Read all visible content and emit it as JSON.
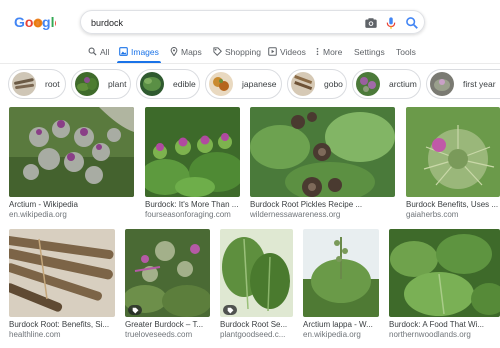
{
  "logo": {
    "text": "Google"
  },
  "search": {
    "query": "burdock"
  },
  "tabs": [
    {
      "label": "All",
      "icon": "search-icon"
    },
    {
      "label": "Images",
      "icon": "image-icon",
      "active": true
    },
    {
      "label": "Maps",
      "icon": "map-pin-icon"
    },
    {
      "label": "Shopping",
      "icon": "tag-icon"
    },
    {
      "label": "Videos",
      "icon": "play-icon"
    },
    {
      "label": "More",
      "icon": "more-vert-icon"
    },
    {
      "label": "Settings"
    },
    {
      "label": "Tools"
    }
  ],
  "chips": [
    {
      "label": "root"
    },
    {
      "label": "plant"
    },
    {
      "label": "edible"
    },
    {
      "label": "japanese"
    },
    {
      "label": "gobo"
    },
    {
      "label": "arctium"
    },
    {
      "label": "first year"
    }
  ],
  "results": [
    {
      "title": "Arctium - Wikipedia",
      "site": "en.wikipedia.org"
    },
    {
      "title": "Burdock: It's More Than ...",
      "site": "fourseasonforaging.com"
    },
    {
      "title": "Burdock Root Pickles Recipe ...",
      "site": "wildernessawareness.org"
    },
    {
      "title": "Burdock Benefits, Uses ...",
      "site": "gaiaherbs.com"
    },
    {
      "title": "Burdock Root: Benefits, Si...",
      "site": "healthline.com"
    },
    {
      "title": "Greater Burdock – T...",
      "site": "trueloveseeds.com"
    },
    {
      "title": "Burdock Root Se...",
      "site": "plantgoodseed.c..."
    },
    {
      "title": "Arctium lappa - W...",
      "site": "en.wikipedia.org"
    },
    {
      "title": "Burdock: A Food That Wi...",
      "site": "northernwoodlands.org"
    }
  ],
  "colors": {
    "accent": "#1a73e8",
    "logo_blue": "#4285f4",
    "logo_red": "#ea4335",
    "logo_yellow": "#fbbc05",
    "logo_green": "#34a853"
  }
}
